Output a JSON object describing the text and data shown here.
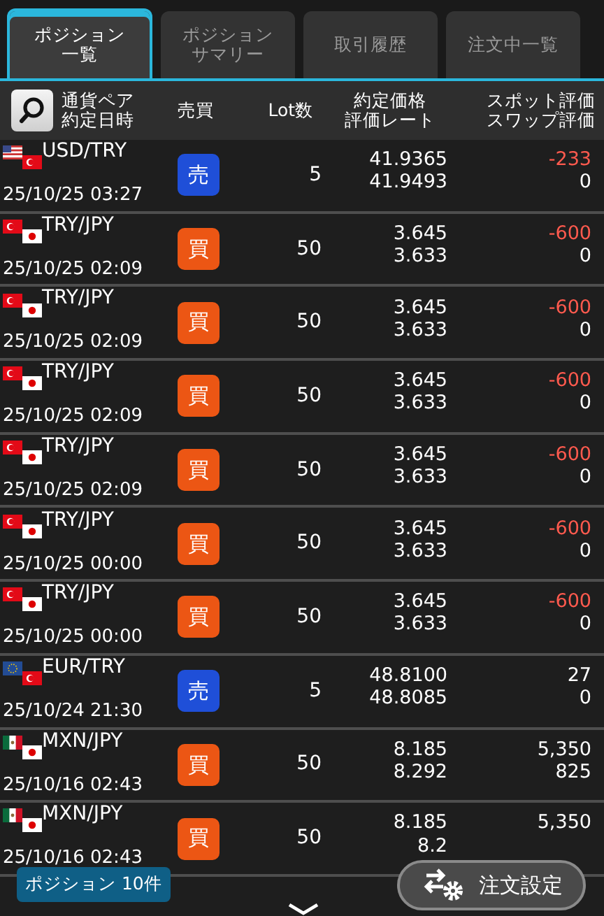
{
  "tabs": [
    {
      "label": [
        "ポジション",
        "一覧"
      ],
      "selected": true
    },
    {
      "label": [
        "ポジション",
        "サマリー"
      ],
      "selected": false
    },
    {
      "label": "取引履歴",
      "selected": false
    },
    {
      "label": "注文中一覧",
      "selected": false
    }
  ],
  "header": {
    "pair_date": [
      "通貨ペア",
      "約定日時"
    ],
    "side": "売買",
    "lot": "Lot数",
    "rates": [
      "約定価格",
      "評価レート"
    ],
    "pl": [
      "スポット評価",
      "スワップ評価"
    ]
  },
  "positions": [
    {
      "pair": "USD/TRY",
      "flags": [
        {
          "kind": "us"
        },
        {
          "kind": "tr"
        }
      ],
      "date": "25/10/25 03:27",
      "side": "売",
      "kind": "sell",
      "lot": "5",
      "rate": "41.9365",
      "eval_rate": "41.9493",
      "spot": "-233",
      "negative": true,
      "swap": "0"
    },
    {
      "pair": "TRY/JPY",
      "flags": [
        {
          "kind": "tr"
        },
        {
          "kind": "jp"
        }
      ],
      "date": "25/10/25 02:09",
      "side": "買",
      "kind": "buy",
      "lot": "50",
      "rate": "3.645",
      "eval_rate": "3.633",
      "spot": "-600",
      "negative": true,
      "swap": "0"
    },
    {
      "pair": "TRY/JPY",
      "flags": [
        {
          "kind": "tr"
        },
        {
          "kind": "jp"
        }
      ],
      "date": "25/10/25 02:09",
      "side": "買",
      "kind": "buy",
      "lot": "50",
      "rate": "3.645",
      "eval_rate": "3.633",
      "spot": "-600",
      "negative": true,
      "swap": "0"
    },
    {
      "pair": "TRY/JPY",
      "flags": [
        {
          "kind": "tr"
        },
        {
          "kind": "jp"
        }
      ],
      "date": "25/10/25 02:09",
      "side": "買",
      "kind": "buy",
      "lot": "50",
      "rate": "3.645",
      "eval_rate": "3.633",
      "spot": "-600",
      "negative": true,
      "swap": "0"
    },
    {
      "pair": "TRY/JPY",
      "flags": [
        {
          "kind": "tr"
        },
        {
          "kind": "jp"
        }
      ],
      "date": "25/10/25 02:09",
      "side": "買",
      "kind": "buy",
      "lot": "50",
      "rate": "3.645",
      "eval_rate": "3.633",
      "spot": "-600",
      "negative": true,
      "swap": "0"
    },
    {
      "pair": "TRY/JPY",
      "flags": [
        {
          "kind": "tr"
        },
        {
          "kind": "jp"
        }
      ],
      "date": "25/10/25 00:00",
      "side": "買",
      "kind": "buy",
      "lot": "50",
      "rate": "3.645",
      "eval_rate": "3.633",
      "spot": "-600",
      "negative": true,
      "swap": "0"
    },
    {
      "pair": "TRY/JPY",
      "flags": [
        {
          "kind": "tr"
        },
        {
          "kind": "jp"
        }
      ],
      "date": "25/10/25 00:00",
      "side": "買",
      "kind": "buy",
      "lot": "50",
      "rate": "3.645",
      "eval_rate": "3.633",
      "spot": "-600",
      "negative": true,
      "swap": "0"
    },
    {
      "pair": "EUR/TRY",
      "flags": [
        {
          "kind": "eu"
        },
        {
          "kind": "tr"
        }
      ],
      "date": "25/10/24 21:30",
      "side": "売",
      "kind": "sell",
      "lot": "5",
      "rate": "48.8100",
      "eval_rate": "48.8085",
      "spot": "27",
      "negative": false,
      "swap": "0"
    },
    {
      "pair": "MXN/JPY",
      "flags": [
        {
          "kind": "mx"
        },
        {
          "kind": "jp"
        }
      ],
      "date": "25/10/16 02:43",
      "side": "買",
      "kind": "buy",
      "lot": "50",
      "rate": "8.185",
      "eval_rate": "8.292",
      "spot": "5,350",
      "negative": false,
      "swap": "825"
    },
    {
      "pair": "MXN/JPY",
      "flags": [
        {
          "kind": "mx"
        },
        {
          "kind": "jp"
        }
      ],
      "date": "25/10/16 02:43",
      "side": "買",
      "kind": "buy",
      "lot": "50",
      "rate": "8.185",
      "eval_rate": "8.2",
      "spot": "5,350",
      "negative": false
    }
  ],
  "count_badge": "ポジション 10件",
  "order_settings_button": "注文設定"
}
